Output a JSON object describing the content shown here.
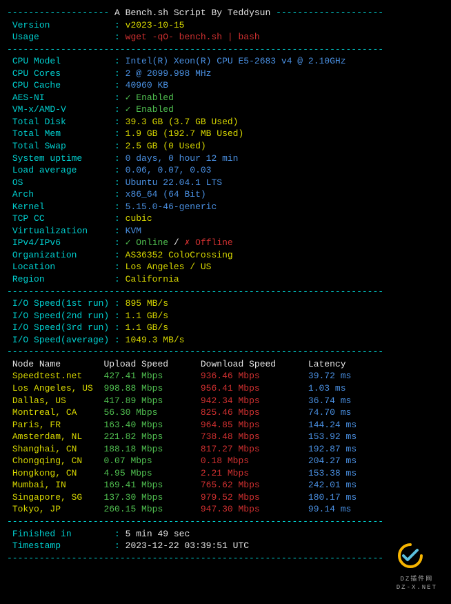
{
  "header": {
    "title": "A Bench.sh Script By Teddysun"
  },
  "info": {
    "version_label": "Version",
    "version": "v2023-10-15",
    "usage_label": "Usage",
    "usage": "wget -qO- bench.sh | bash"
  },
  "sys": {
    "cpu_model_label": "CPU Model",
    "cpu_model": "Intel(R) Xeon(R) CPU E5-2683 v4 @ 2.10GHz",
    "cpu_cores_label": "CPU Cores",
    "cpu_cores": "2 @ 2099.998 MHz",
    "cpu_cache_label": "CPU Cache",
    "cpu_cache": "40960 KB",
    "aesni_label": "AES-NI",
    "aesni": "✓ Enabled",
    "vmx_label": "VM-x/AMD-V",
    "vmx": "✓ Enabled",
    "disk_label": "Total Disk",
    "disk": "39.3 GB (3.7 GB Used)",
    "mem_label": "Total Mem",
    "mem": "1.9 GB (192.7 MB Used)",
    "swap_label": "Total Swap",
    "swap": "2.5 GB (0 Used)",
    "uptime_label": "System uptime",
    "uptime": "0 days, 0 hour 12 min",
    "load_label": "Load average",
    "load": "0.06, 0.07, 0.03",
    "os_label": "OS",
    "os": "Ubuntu 22.04.1 LTS",
    "arch_label": "Arch",
    "arch": "x86_64 (64 Bit)",
    "kernel_label": "Kernel",
    "kernel": "5.15.0-46-generic",
    "tcpcc_label": "TCP CC",
    "tcpcc": "cubic",
    "virt_label": "Virtualization",
    "virt": "KVM",
    "ipv_label": "IPv4/IPv6",
    "ipv4": "✓ Online",
    "ipv_sep": " / ",
    "ipv6": "✗ Offline",
    "org_label": "Organization",
    "org": "AS36352 ColoCrossing",
    "loc_label": "Location",
    "loc": "Los Angeles / US",
    "region_label": "Region",
    "region": "California"
  },
  "io": {
    "r1_label": "I/O Speed(1st run) ",
    "r1": "895 MB/s",
    "r2_label": "I/O Speed(2nd run) ",
    "r2": "1.1 GB/s",
    "r3_label": "I/O Speed(3rd run) ",
    "r3": "1.1 GB/s",
    "avg_label": "I/O Speed(average) ",
    "avg": "1049.3 MB/s"
  },
  "speedtest": {
    "h_node": "Node Name",
    "h_up": "Upload Speed",
    "h_down": "Download Speed",
    "h_lat": "Latency",
    "rows": [
      {
        "n": "Speedtest.net",
        "u": "427.41 Mbps",
        "d": "936.46 Mbps",
        "l": "39.72 ms"
      },
      {
        "n": "Los Angeles, US",
        "u": "998.88 Mbps",
        "d": "956.41 Mbps",
        "l": "1.03 ms"
      },
      {
        "n": "Dallas, US",
        "u": "417.89 Mbps",
        "d": "942.34 Mbps",
        "l": "36.74 ms"
      },
      {
        "n": "Montreal, CA",
        "u": "56.30 Mbps",
        "d": "825.46 Mbps",
        "l": "74.70 ms"
      },
      {
        "n": "Paris, FR",
        "u": "163.40 Mbps",
        "d": "964.85 Mbps",
        "l": "144.24 ms"
      },
      {
        "n": "Amsterdam, NL",
        "u": "221.82 Mbps",
        "d": "738.48 Mbps",
        "l": "153.92 ms"
      },
      {
        "n": "Shanghai, CN",
        "u": "188.18 Mbps",
        "d": "817.27 Mbps",
        "l": "192.87 ms"
      },
      {
        "n": "Chongqing, CN",
        "u": "0.07 Mbps",
        "d": "0.18 Mbps",
        "l": "204.27 ms"
      },
      {
        "n": "Hongkong, CN",
        "u": "4.95 Mbps",
        "d": "2.21 Mbps",
        "l": "153.38 ms"
      },
      {
        "n": "Mumbai, IN",
        "u": "169.41 Mbps",
        "d": "765.62 Mbps",
        "l": "242.01 ms"
      },
      {
        "n": "Singapore, SG",
        "u": "137.30 Mbps",
        "d": "979.52 Mbps",
        "l": "180.17 ms"
      },
      {
        "n": "Tokyo, JP",
        "u": "260.15 Mbps",
        "d": "947.30 Mbps",
        "l": "99.14 ms"
      }
    ]
  },
  "footer": {
    "finished_label": "Finished in",
    "finished": "5 min 49 sec",
    "timestamp_label": "Timestamp",
    "timestamp": "2023-12-22 03:39:51 UTC"
  },
  "watermark": {
    "brand": "DZ插件网",
    "sub": "DZ-X.NET"
  },
  "sep": "----------------------------------------------------------------------"
}
